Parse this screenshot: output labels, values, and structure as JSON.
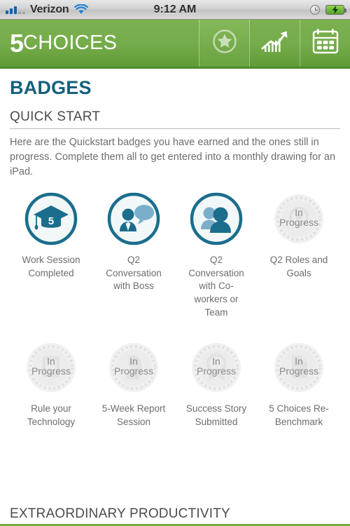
{
  "status_bar": {
    "carrier": "Verizon",
    "time": "9:12 AM",
    "signal_icon": "signal-bars-icon",
    "wifi_icon": "wifi-icon",
    "alarm_icon": "clock-icon",
    "battery_icon": "battery-charging-icon"
  },
  "header": {
    "logo_number": "5",
    "logo_word": "CHOICES",
    "nav": [
      {
        "name": "badges",
        "icon": "star-badge-icon",
        "active": true
      },
      {
        "name": "progress",
        "icon": "trending-chart-icon",
        "active": false
      },
      {
        "name": "calendar",
        "icon": "calendar-icon",
        "active": false
      }
    ]
  },
  "main": {
    "page_title": "BADGES",
    "section_title": "QUICK START",
    "intro": "Here are the Quickstart badges you have earned and the ones still in progress. Complete them all to get entered into a monthly drawing for an iPad.",
    "in_progress_line1": "In",
    "in_progress_line2": "Progress",
    "badges": [
      {
        "label": "Work Session Completed",
        "state": "earned",
        "icon": "graduation-cap-icon",
        "cap_number": "5"
      },
      {
        "label": "Q2 Conversation with Boss",
        "state": "earned",
        "icon": "person-speech-bubble-icon"
      },
      {
        "label": "Q2 Conversation with Co-workers or Team",
        "state": "earned",
        "icon": "two-people-icon"
      },
      {
        "label": "Q2 Roles and Goals",
        "state": "in-progress",
        "icon": "target-icon"
      },
      {
        "label": "Rule your Technology",
        "state": "in-progress",
        "icon": "device-icon"
      },
      {
        "label": "5-Week Report Session",
        "state": "in-progress",
        "icon": "document-person-icon"
      },
      {
        "label": "Success Story Submitted",
        "state": "in-progress",
        "icon": "award-ribbon-icon"
      },
      {
        "label": "5 Choices Re-Benchmark",
        "state": "in-progress",
        "icon": "clipboard-icon"
      }
    ]
  },
  "next_section": {
    "title": "EXTRAORDINARY PRODUCTIVITY"
  },
  "colors": {
    "brand_green": "#76ad4b",
    "title_teal": "#15607d",
    "badge_teal": "#1b6d8c",
    "badge_light_blue": "#7aafc9",
    "in_progress_gray": "#e4e4e4",
    "text_gray": "#6d6d6d"
  }
}
